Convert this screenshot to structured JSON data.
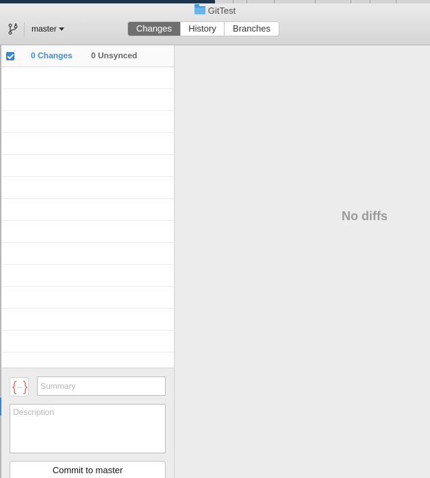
{
  "window": {
    "title": "GitTest"
  },
  "toolbar": {
    "branch_name": "master",
    "tabs": [
      {
        "label": "Changes",
        "active": true
      },
      {
        "label": "History",
        "active": false
      },
      {
        "label": "Branches",
        "active": false
      }
    ]
  },
  "sidebar": {
    "select_all_checked": true,
    "changes_label": "0 Changes",
    "unsynced_label": "0 Unsynced",
    "file_rows": 14
  },
  "commit": {
    "summary_value": "",
    "summary_placeholder": "Summary",
    "description_value": "",
    "description_placeholder": "Description",
    "button_label": "Commit to master"
  },
  "diff": {
    "empty_message": "No diffs"
  },
  "colors": {
    "accent": "#3f8fd6",
    "active_tab": "#6f6f6f",
    "avatar_brackets": "#e0584f"
  },
  "icons": {
    "branch": "branch-icon",
    "folder": "folder-icon",
    "avatar": "avatar-icon"
  }
}
